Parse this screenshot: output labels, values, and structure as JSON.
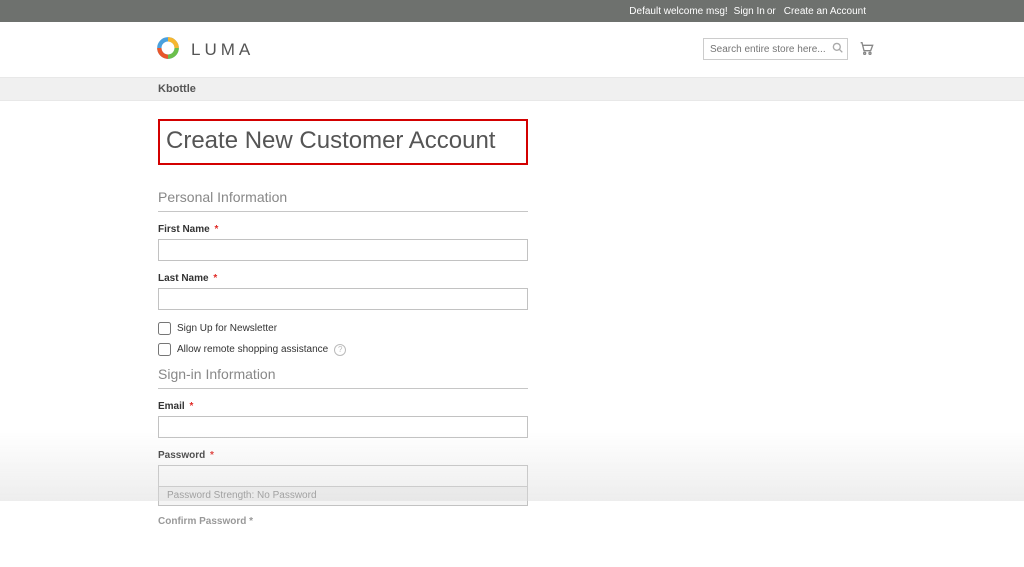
{
  "header": {
    "welcome": "Default welcome msg!",
    "sign_in": "Sign In",
    "or": "or",
    "create_account": "Create an Account"
  },
  "brand": {
    "name": "LUMA"
  },
  "search": {
    "placeholder": "Search entire store here..."
  },
  "nav": {
    "item": "Kbottle"
  },
  "page": {
    "title": "Create New Customer Account"
  },
  "sections": {
    "personal": "Personal Information",
    "signin": "Sign-in Information"
  },
  "labels": {
    "first_name": "First Name",
    "last_name": "Last Name",
    "newsletter": "Sign Up for Newsletter",
    "remote_assist": "Allow remote shopping assistance",
    "email": "Email",
    "password": "Password",
    "confirm_password": "Confirm Password",
    "pw_strength": "Password Strength: No Password",
    "required": "*"
  }
}
